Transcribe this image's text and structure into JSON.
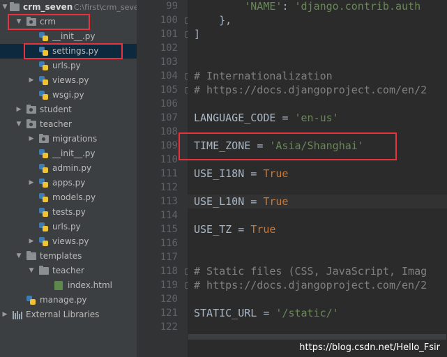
{
  "project": {
    "name": "crm_seven",
    "path": "C:\\first\\crm_seve"
  },
  "tree": [
    {
      "label": "crm",
      "kind": "package",
      "arrow": "down",
      "indent": 1
    },
    {
      "label": "__init__.py",
      "kind": "py",
      "arrow": "",
      "indent": 2
    },
    {
      "label": "settings.py",
      "kind": "py",
      "arrow": "",
      "indent": 2,
      "selected": true
    },
    {
      "label": "urls.py",
      "kind": "py",
      "arrow": "",
      "indent": 2
    },
    {
      "label": "views.py",
      "kind": "py",
      "arrow": "right",
      "indent": 2
    },
    {
      "label": "wsgi.py",
      "kind": "py",
      "arrow": "",
      "indent": 2
    },
    {
      "label": "student",
      "kind": "package",
      "arrow": "right",
      "indent": 1
    },
    {
      "label": "teacher",
      "kind": "package",
      "arrow": "down",
      "indent": 1
    },
    {
      "label": "migrations",
      "kind": "package",
      "arrow": "right",
      "indent": 2
    },
    {
      "label": "__init__.py",
      "kind": "py",
      "arrow": "",
      "indent": 2
    },
    {
      "label": "admin.py",
      "kind": "py",
      "arrow": "",
      "indent": 2
    },
    {
      "label": "apps.py",
      "kind": "py",
      "arrow": "right",
      "indent": 2
    },
    {
      "label": "models.py",
      "kind": "py",
      "arrow": "",
      "indent": 2
    },
    {
      "label": "tests.py",
      "kind": "py",
      "arrow": "",
      "indent": 2
    },
    {
      "label": "urls.py",
      "kind": "py",
      "arrow": "",
      "indent": 2
    },
    {
      "label": "views.py",
      "kind": "py",
      "arrow": "right",
      "indent": 2
    },
    {
      "label": "templates",
      "kind": "folder",
      "arrow": "down",
      "indent": 1
    },
    {
      "label": "teacher",
      "kind": "folder",
      "arrow": "down",
      "indent": 2
    },
    {
      "label": "index.html",
      "kind": "html",
      "arrow": "",
      "indent": 3
    },
    {
      "label": "manage.py",
      "kind": "py",
      "arrow": "",
      "indent": 1
    },
    {
      "label": "External Libraries",
      "kind": "lib",
      "arrow": "right",
      "indent": 0
    }
  ],
  "editor": {
    "line_numbers": [
      "99",
      "100",
      "101",
      "102",
      "103",
      "104",
      "105",
      "106",
      "107",
      "108",
      "109",
      "110",
      "111",
      "112",
      "113",
      "114",
      "115",
      "116",
      "117",
      "118",
      "119",
      "120",
      "121",
      "122"
    ],
    "lines": [
      [
        {
          "t": "        ",
          "c": "t-id"
        },
        {
          "t": "'NAME'",
          "c": "t-str"
        },
        {
          "t": ": ",
          "c": "t-id"
        },
        {
          "t": "'django.contrib.auth",
          "c": "t-str"
        }
      ],
      [
        {
          "t": "    },",
          "c": "t-id"
        }
      ],
      [
        {
          "t": "]",
          "c": "t-id"
        }
      ],
      [],
      [],
      [
        {
          "t": "# Internationalization",
          "c": "t-com"
        }
      ],
      [
        {
          "t": "# https://docs.djangoproject.com/en/2",
          "c": "t-com"
        }
      ],
      [],
      [
        {
          "t": "LANGUAGE_CODE ",
          "c": "t-id"
        },
        {
          "t": "= ",
          "c": "t-op"
        },
        {
          "t": "'en-us'",
          "c": "t-str"
        }
      ],
      [],
      [
        {
          "t": "TIME_ZONE ",
          "c": "t-id"
        },
        {
          "t": "= ",
          "c": "t-op"
        },
        {
          "t": "'Asia/Shanghai'",
          "c": "t-str"
        }
      ],
      [],
      [
        {
          "t": "USE_I18N ",
          "c": "t-id"
        },
        {
          "t": "= ",
          "c": "t-op"
        },
        {
          "t": "True",
          "c": "t-kw"
        }
      ],
      [],
      [
        {
          "t": "USE_L10N ",
          "c": "t-id"
        },
        {
          "t": "= ",
          "c": "t-op"
        },
        {
          "t": "True",
          "c": "t-kw"
        }
      ],
      [],
      [
        {
          "t": "USE_TZ ",
          "c": "t-id"
        },
        {
          "t": "= ",
          "c": "t-op"
        },
        {
          "t": "True",
          "c": "t-kw"
        }
      ],
      [],
      [],
      [
        {
          "t": "# Static files (CSS, JavaScript, Imag",
          "c": "t-com"
        }
      ],
      [
        {
          "t": "# https://docs.djangoproject.com/en/2",
          "c": "t-com"
        }
      ],
      [],
      [
        {
          "t": "STATIC_URL ",
          "c": "t-id"
        },
        {
          "t": "= ",
          "c": "t-op"
        },
        {
          "t": "'/static/'",
          "c": "t-str"
        }
      ],
      []
    ],
    "current_line_index": 14
  },
  "watermark": "https://blog.csdn.net/Hello_Fsir",
  "colors": {
    "highlight_box": "#e8323c",
    "selection": "#0d293e"
  }
}
